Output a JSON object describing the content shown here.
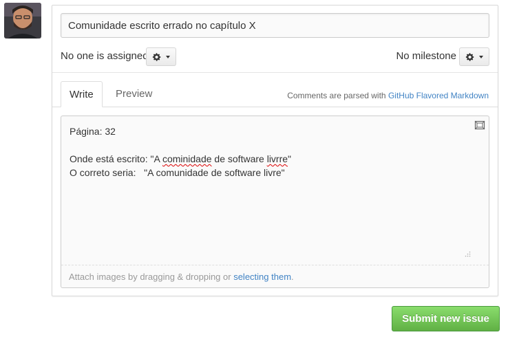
{
  "issue": {
    "title_value": "Comunidade escrito errado no capítulo X"
  },
  "meta": {
    "assignee_text": "No one is assigned",
    "milestone_text": "No milestone"
  },
  "tabs": [
    {
      "label": "Write",
      "active": true
    },
    {
      "label": "Preview",
      "active": false
    }
  ],
  "markdown_note": {
    "prefix": "Comments are parsed with ",
    "link": "GitHub Flavored Markdown"
  },
  "editor": {
    "line1": "Página: 32",
    "line3_prefix": "Onde está escrito: \"A ",
    "line3_misspelled_1": "cominidade",
    "line3_middle": " de software ",
    "line3_misspelled_2": "livrre",
    "line3_suffix": "\"",
    "line4": "O correto seria:   \"A comunidade de software livre\""
  },
  "attach": {
    "prefix": "Attach images by dragging & dropping or ",
    "link": "selecting them",
    "suffix": "."
  },
  "submit_label": "Submit new issue",
  "icons": {
    "gear": "gear-icon",
    "fullscreen": "fullscreen-icon"
  },
  "colors": {
    "submit_green": "#60b044",
    "link_blue": "#4183c4"
  }
}
